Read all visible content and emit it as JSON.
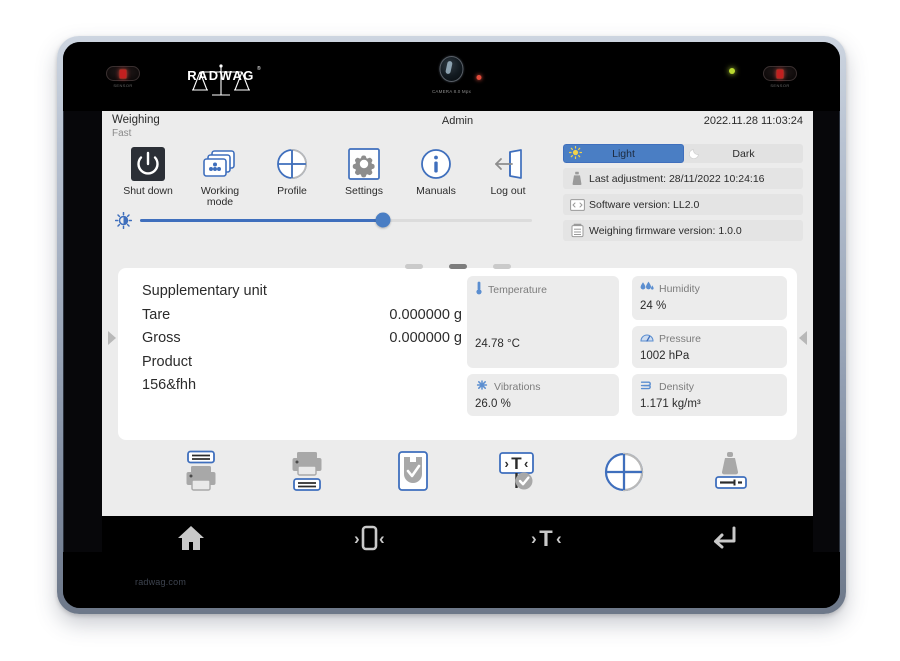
{
  "device": {
    "brand": "RADWAG",
    "site_url": "radwag.com",
    "sensor_label_left": "SENSOR",
    "sensor_label_right": "SENSOR",
    "camera_label": "CAMERA 8.0 Mpx"
  },
  "topbar": {
    "title": "Weighing",
    "subtitle": "Fast",
    "user": "Admin",
    "datetime": "2022.11.28 11:03:24"
  },
  "quick_actions": [
    {
      "label": "Shut down",
      "icon": "power-icon"
    },
    {
      "label": "Working\nmode",
      "label_l1": "Working",
      "label_l2": "mode",
      "icon": "working-mode-icon"
    },
    {
      "label": "Profile",
      "icon": "profile-icon"
    },
    {
      "label": "Settings",
      "icon": "gear-icon"
    },
    {
      "label": "Manuals",
      "icon": "info-icon"
    },
    {
      "label": "Log out",
      "icon": "logout-icon"
    }
  ],
  "brightness": {
    "icon": "brightness-icon",
    "value_percent": 62
  },
  "theme": {
    "light_label": "Light",
    "dark_label": "Dark",
    "selected": "Light",
    "light_icon": "sun-icon",
    "dark_icon": "moon-icon"
  },
  "info_rows": [
    {
      "icon": "adjustment-icon",
      "text": "Last adjustment: 28/11/2022 10:24:16"
    },
    {
      "icon": "software-icon",
      "text": "Software version: LL2.0"
    },
    {
      "icon": "firmware-icon",
      "text": "Weighing firmware version: 1.0.0"
    }
  ],
  "readings": [
    {
      "label": "Supplementary unit",
      "value": ""
    },
    {
      "label": "Tare",
      "value": "0.000000 g"
    },
    {
      "label": "Gross",
      "value": "0.000000 g"
    },
    {
      "label": "Product",
      "value": ""
    },
    {
      "label": "156&fhh",
      "value": ""
    }
  ],
  "sensors": [
    {
      "id": "temperature",
      "title": "Temperature",
      "value": "24.78 °C",
      "icon": "thermometer-icon"
    },
    {
      "id": "humidity",
      "title": "Humidity",
      "value": "24 %",
      "icon": "droplet-icon"
    },
    {
      "id": "pressure",
      "title": "Pressure",
      "value": "1002 hPa",
      "icon": "gauge-icon"
    },
    {
      "id": "vibrations",
      "title": "Vibrations",
      "value": "26.0 %",
      "icon": "vibration-icon"
    },
    {
      "id": "density",
      "title": "Density",
      "value": "1.171 kg/m³",
      "icon": "density-icon"
    }
  ],
  "page_indicator": {
    "count": 3,
    "active_index": 1
  },
  "toolbar_buttons": [
    {
      "name": "print-header-button",
      "icon": "printer-header-icon"
    },
    {
      "name": "print-footer-button",
      "icon": "printer-footer-icon"
    },
    {
      "name": "product-check-button",
      "icon": "product-check-icon"
    },
    {
      "name": "tare-confirm-button",
      "icon": "tare-confirm-icon"
    },
    {
      "name": "profile-button",
      "icon": "profile-pie-icon"
    },
    {
      "name": "calibration-button",
      "icon": "weight-adjust-icon"
    }
  ],
  "navbar": [
    {
      "name": "home-button",
      "icon": "home-icon"
    },
    {
      "name": "zero-button",
      "icon": "zero-icon"
    },
    {
      "name": "tare-button",
      "icon": "tare-icon"
    },
    {
      "name": "enter-button",
      "icon": "enter-icon"
    }
  ],
  "colors": {
    "accent_blue": "#3f6fbd",
    "thumb_blue": "#4a7ec4",
    "icon_blue": "#3f6fbd",
    "icon_gray": "#9a9a9a",
    "screen_bg": "#ececec",
    "card_bg": "#ffffff",
    "sensor_card_bg": "#ececec",
    "navbar_bg": "#000000",
    "text_primary": "#2b2b2b",
    "text_muted": "#8a8a8a"
  },
  "side_arrows": {
    "left": "prev-screen-arrow",
    "right": "next-screen-arrow"
  }
}
